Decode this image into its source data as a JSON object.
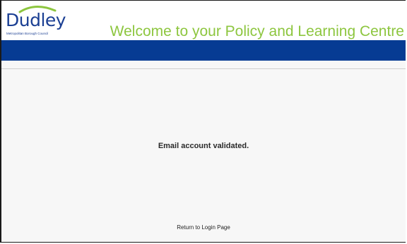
{
  "header": {
    "logo": {
      "name": "Dudley",
      "subtitle": "Metropolitan Borough Council"
    },
    "welcome_text": "Welcome to your Policy and Learning Centre"
  },
  "main": {
    "message": "Email account validated.",
    "return_link": "Return to Login Page"
  },
  "colors": {
    "brand_blue": "#063b93",
    "welcome_green": "#8dc63f",
    "logo_blue": "#1b3f93"
  }
}
